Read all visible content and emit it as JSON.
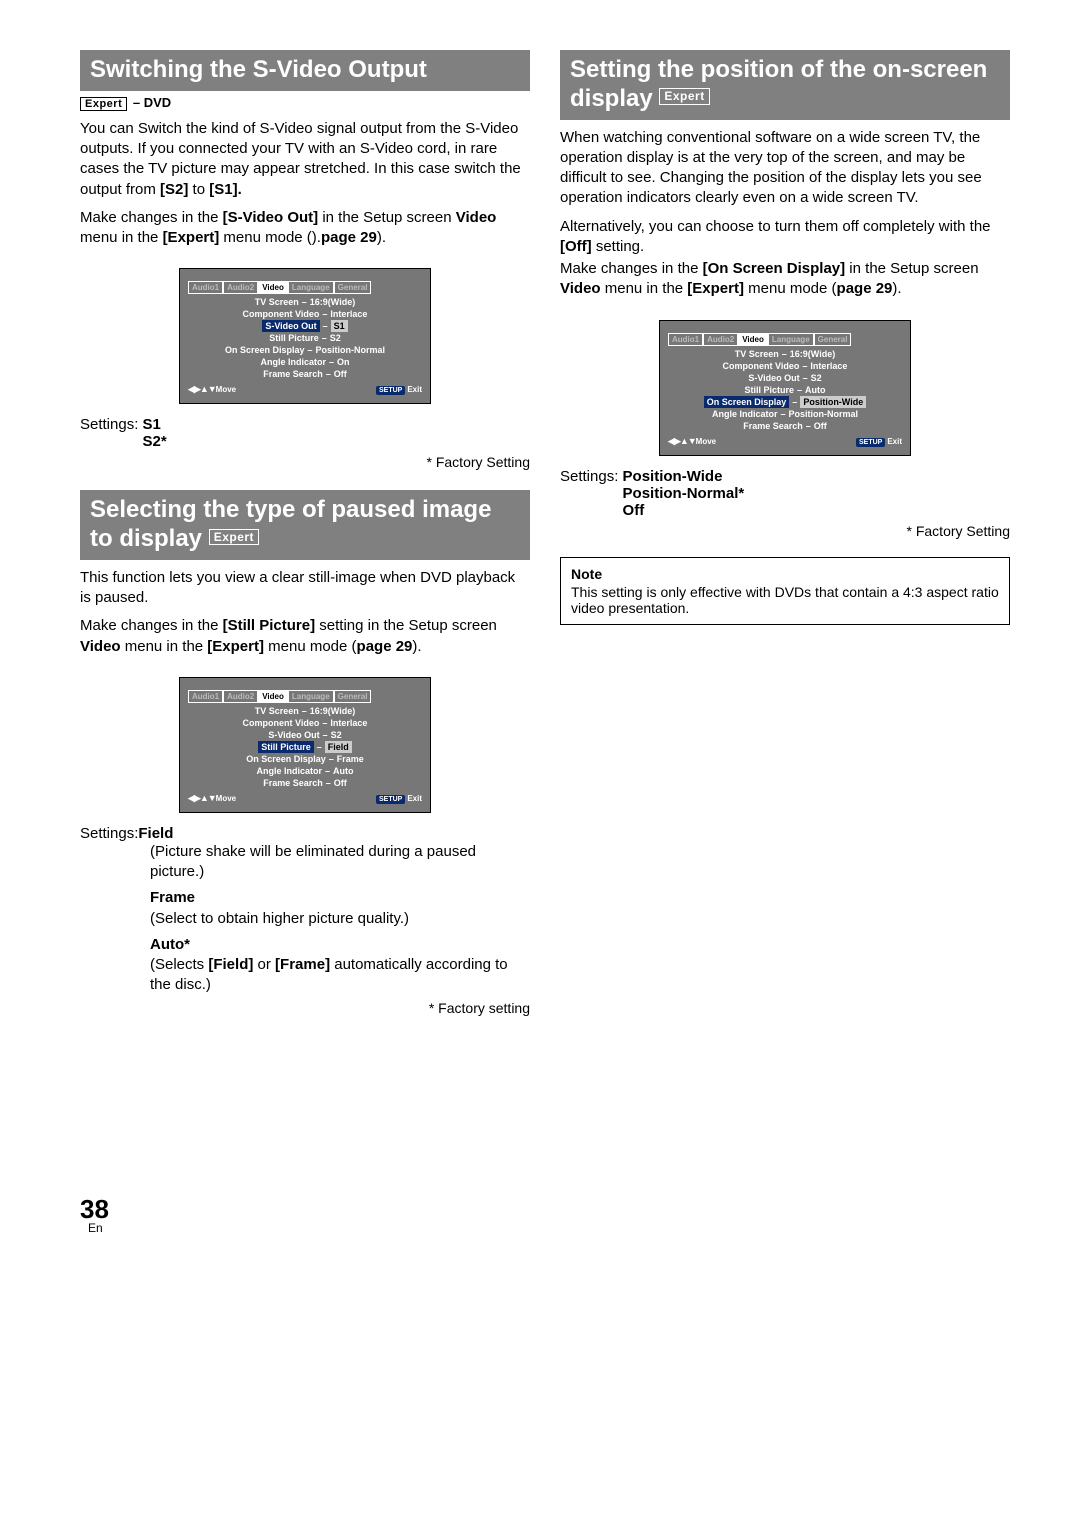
{
  "page_number": "38",
  "page_lang": "En",
  "left": {
    "section1": {
      "title": "Switching the S-Video Output",
      "badge": "Expert",
      "badge_suffix": " – DVD",
      "para1": "You can Switch the kind of S-Video signal output from the S-Video outputs. If you connected your TV with an S-Video cord, in rare cases the TV picture may appear stretched. In this case switch the output from ",
      "para1_b1": "[S2]",
      "para1_mid": " to ",
      "para1_b2": "[S1].",
      "para2_a": "Make changes in the ",
      "para2_b1": "[S-Video Out]",
      "para2_b": " in the Setup screen ",
      "para2_b2": "Video",
      "para2_c": " menu in the ",
      "para2_b3": "[Expert]",
      "para2_d": " menu mode (",
      "para2_b4": "page 29",
      "para2_e": ").",
      "settings_label": "Settings: ",
      "settings_v1": "S1",
      "settings_v2": "S2*",
      "factory": "* Factory Setting",
      "screen": {
        "tabs": [
          "Audio1",
          "Audio2",
          "Video",
          "Language",
          "General"
        ],
        "lines": [
          {
            "l": "TV Screen",
            "r": "16:9(Wide)"
          },
          {
            "l": "Component Video",
            "r": "Interlace"
          }
        ],
        "highlight": {
          "l": "S-Video Out",
          "opts": [
            "S1",
            "S2"
          ]
        },
        "lines2": [
          {
            "l": "Still Picture",
            "r": ""
          },
          {
            "l": "On Screen Display",
            "r": "Position-Normal"
          },
          {
            "l": "Angle Indicator",
            "r": "On"
          },
          {
            "l": "Frame Search",
            "r": "Off"
          }
        ],
        "move": "Move",
        "setup": "SETUP",
        "exit": "Exit"
      }
    },
    "section2": {
      "title_a": "Selecting the type of paused image to display ",
      "badge": "Expert",
      "para1": "This function lets you view a clear still-image when DVD playback is paused.",
      "para2_a": "Make changes in the ",
      "para2_b1": "[Still Picture]",
      "para2_b": " setting in the Setup screen ",
      "para2_b2": "Video",
      "para2_c": " menu in the ",
      "para2_b3": "[Expert]",
      "para2_d": " menu mode (",
      "para2_b4": "page 29",
      "para2_e": ").",
      "settings_label": "Settings: ",
      "opt1": "Field",
      "opt1_desc": "(Picture shake will be eliminated during a paused picture.)",
      "opt2": "Frame",
      "opt2_desc": "(Select to obtain higher picture quality.)",
      "opt3": "Auto*",
      "opt3_desc_a": "(Selects ",
      "opt3_desc_b1": "[Field]",
      "opt3_desc_b": " or ",
      "opt3_desc_b2": "[Frame]",
      "opt3_desc_c": " automatically according to the disc.)",
      "factory": "* Factory setting",
      "screen": {
        "tabs": [
          "Audio1",
          "Audio2",
          "Video",
          "Language",
          "General"
        ],
        "lines": [
          {
            "l": "TV Screen",
            "r": "16:9(Wide)"
          },
          {
            "l": "Component Video",
            "r": "Interlace"
          },
          {
            "l": "S-Video Out",
            "r": "S2"
          }
        ],
        "highlight": {
          "l": "Still Picture",
          "opts": [
            "Field",
            "Frame",
            "Auto"
          ]
        },
        "lines2": [
          {
            "l": "On Screen Display",
            "r": ""
          },
          {
            "l": "Angle Indicator",
            "r": ""
          },
          {
            "l": "Frame Search",
            "r": "Off"
          }
        ],
        "move": "Move",
        "setup": "SETUP",
        "exit": "Exit"
      }
    }
  },
  "right": {
    "section1": {
      "title_a": "Setting the position of the on-screen display ",
      "badge": "Expert",
      "para1": "When watching conventional software on a wide screen TV, the operation display is at the very top of the screen, and may be difficult to see. Changing the position of the display lets you see operation indicators clearly even on a wide screen TV.",
      "para2_a": "Alternatively, you can choose to turn them off completely with the ",
      "para2_b1": "[Off]",
      "para2_b": " setting.",
      "para3_a": "Make changes in the ",
      "para3_b1": "[On Screen Display]",
      "para3_b": " in the Setup screen ",
      "para3_b2": "Video",
      "para3_c": " menu in the ",
      "para3_b3": "[Expert]",
      "para3_d": " menu mode (",
      "para3_b4": "page 29",
      "para3_e": ").",
      "settings_label": "Settings: ",
      "opt1": "Position-Wide",
      "opt2": "Position-Normal*",
      "opt3": "Off",
      "factory": "* Factory Setting",
      "note_title": "Note",
      "note_body": "This setting is only effective with DVDs that contain a 4:3 aspect ratio video presentation.",
      "screen": {
        "tabs": [
          "Audio1",
          "Audio2",
          "Video",
          "Language",
          "General"
        ],
        "lines": [
          {
            "l": "TV Screen",
            "r": "16:9(Wide)"
          },
          {
            "l": "Component Video",
            "r": "Interlace"
          },
          {
            "l": "S-Video Out",
            "r": "S2"
          },
          {
            "l": "Still Picture",
            "r": "Auto"
          }
        ],
        "highlight": {
          "l": "On Screen Display",
          "opts": [
            "Position-Wide",
            "Position-Normal",
            "Off"
          ]
        },
        "lines2": [
          {
            "l": "Angle Indicator",
            "r": ""
          },
          {
            "l": "Frame Search",
            "r": ""
          }
        ],
        "move": "Move",
        "setup": "SETUP",
        "exit": "Exit"
      }
    }
  }
}
